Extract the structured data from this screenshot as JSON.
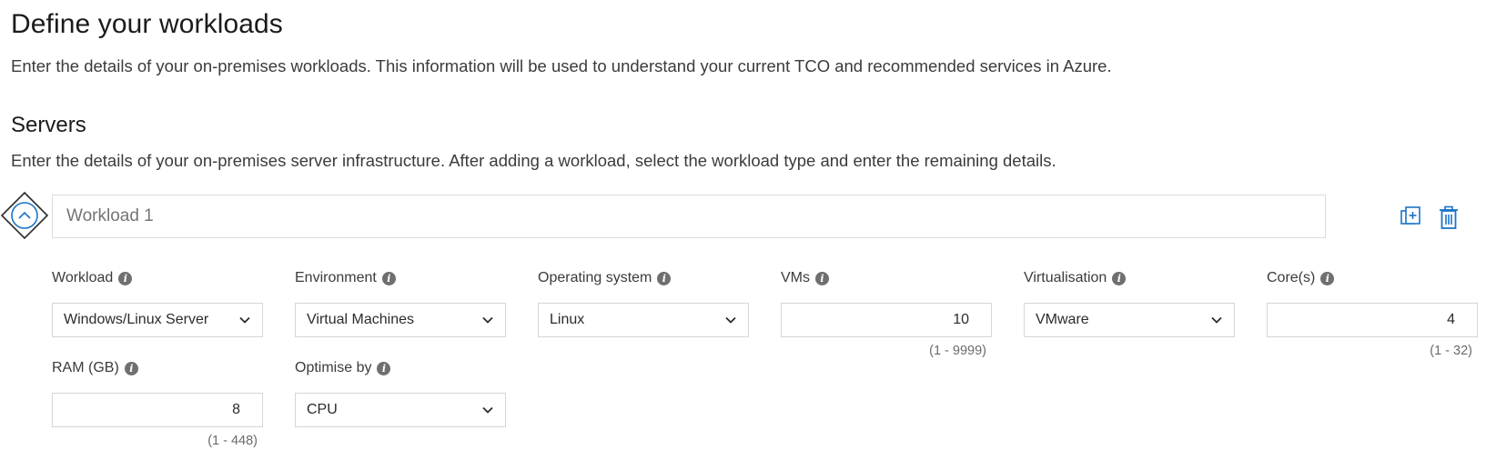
{
  "page": {
    "title": "Define your workloads",
    "description": "Enter the details of your on-premises workloads. This information will be used to understand your current TCO and recommended services in Azure."
  },
  "servers": {
    "title": "Servers",
    "description": "Enter the details of your on-premises server infrastructure. After adding a workload, select the workload type and enter the remaining details."
  },
  "workload": {
    "name_placeholder": "Workload 1",
    "icons": {
      "toggle": "chevron-up-icon",
      "duplicate": "duplicate-icon",
      "delete": "trash-icon"
    },
    "accent_color": "#1a73c7",
    "fields": {
      "workload": {
        "label": "Workload",
        "value": "Windows/Linux Server"
      },
      "environment": {
        "label": "Environment",
        "value": "Virtual Machines"
      },
      "os": {
        "label": "Operating system",
        "value": "Linux"
      },
      "vms": {
        "label": "VMs",
        "value": "10",
        "range": "(1 - 9999)"
      },
      "virtualisation": {
        "label": "Virtualisation",
        "value": "VMware"
      },
      "cores": {
        "label": "Core(s)",
        "value": "4",
        "range": "(1 - 32)"
      },
      "ram": {
        "label": "RAM (GB)",
        "value": "8",
        "range": "(1 - 448)"
      },
      "optimise": {
        "label": "Optimise by",
        "value": "CPU"
      }
    },
    "info_glyph": "i"
  }
}
